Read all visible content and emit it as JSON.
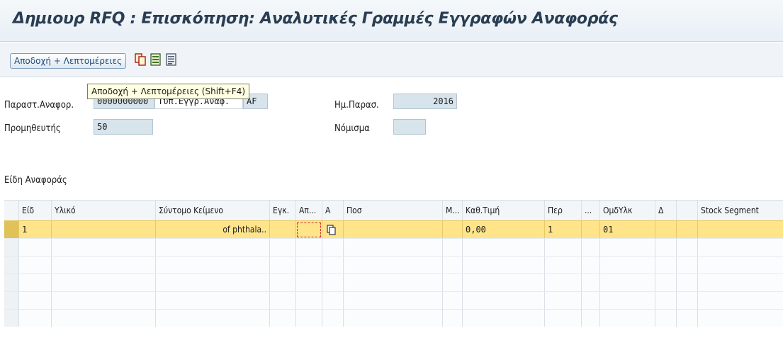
{
  "title": "Δημιουρ RFQ : Επισκόπηση: Αναλυτικές Γραμμές Εγγραφών Αναφοράς",
  "toolbar": {
    "accept_label": "Αποδοχή + Λεπτομέρειες",
    "icons": [
      "copy-icon",
      "document-green-icon",
      "document-blue-icon"
    ]
  },
  "tooltip": "Αποδοχή + Λεπτομέρειες   (Shift+F4)",
  "header": {
    "ref_doc_label": "Παραστ.Αναφορ.",
    "ref_doc_partial": "0000000000",
    "ref_doc_type_partial": "Τύπ.Εγγρ.Αναφ.",
    "ref_doc_code": "AF",
    "date_label": "Ημ.Παρασ.",
    "date_value": "2016",
    "supplier_label": "Προμηθευτής",
    "supplier_value": "50",
    "currency_label": "Νόμισμα",
    "currency_value": ""
  },
  "section_title": "Είδη Αναφοράς",
  "grid": {
    "columns": [
      "Είδ",
      "Υλικό",
      "Σύντομο Κείμενο",
      "Εγκ.",
      "Απ...",
      "Α",
      "Ποσ",
      "Μ...",
      "Καθ.Τιμή",
      "Περ",
      "...",
      "ΟμδΥλκ",
      "Δ",
      "Stock Segment"
    ],
    "rows": [
      {
        "item": "1",
        "material": "",
        "short_text": "of phthala..",
        "plant": "",
        "ap": "",
        "a": "",
        "qty": "",
        "m": "",
        "net_price": "0,00",
        "per": "1",
        "dots": "",
        "mat_group": "01",
        "delta": "",
        "stock_segment": ""
      }
    ],
    "empty_rows": 5
  },
  "colors": {
    "selected_row": "#ffe48a",
    "title_text": "#2a3d52",
    "field_bg": "#d8e4ec",
    "focus_border": "#d22c2c"
  }
}
